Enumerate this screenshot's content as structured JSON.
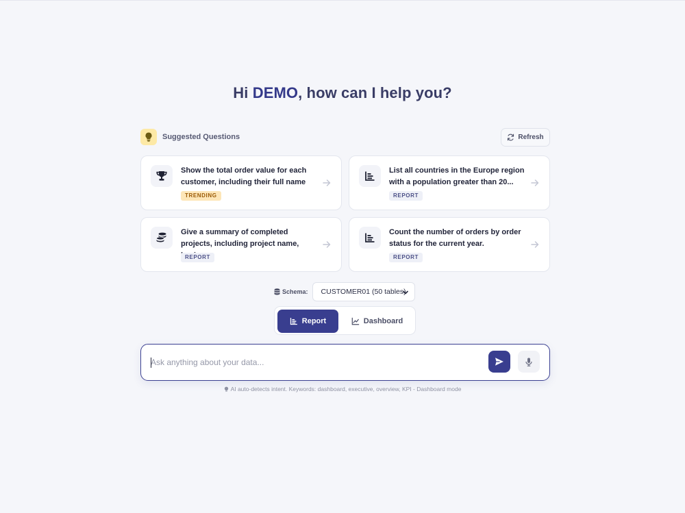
{
  "greeting": {
    "prefix": "Hi ",
    "user": "DEMO",
    "suffix": ", how can I help you?"
  },
  "suggested": {
    "title": "Suggested Questions",
    "refresh_label": "Refresh",
    "cards": [
      {
        "text": "Show the total order value for each customer, including their full name a...",
        "tag": "TRENDING",
        "icon": "trophy-icon"
      },
      {
        "text": "List all countries in the Europe region with a population greater than 20...",
        "tag": "REPORT",
        "icon": "bar-chart-icon"
      },
      {
        "text": "Give a summary of completed projects, including project name, lead,...",
        "tag": "REPORT",
        "icon": "coins-icon"
      },
      {
        "text": "Count the number of orders by order status for the current year.",
        "tag": "REPORT",
        "icon": "bar-chart-icon"
      }
    ]
  },
  "schema": {
    "label": "Schema:",
    "selected": "CUSTOMER01 (50 tables)"
  },
  "modes": {
    "report_label": "Report",
    "dashboard_label": "Dashboard",
    "active": "Report"
  },
  "input": {
    "placeholder": "Ask anything about your data...",
    "value": ""
  },
  "hint": "AI auto-detects intent. Keywords: dashboard, executive, overview, KPI - Dashboard mode",
  "colors": {
    "accent": "#393e8f",
    "trending_bg": "#fde6b8",
    "bulb_bg": "#fde9a6",
    "background": "#f5f6fa"
  }
}
